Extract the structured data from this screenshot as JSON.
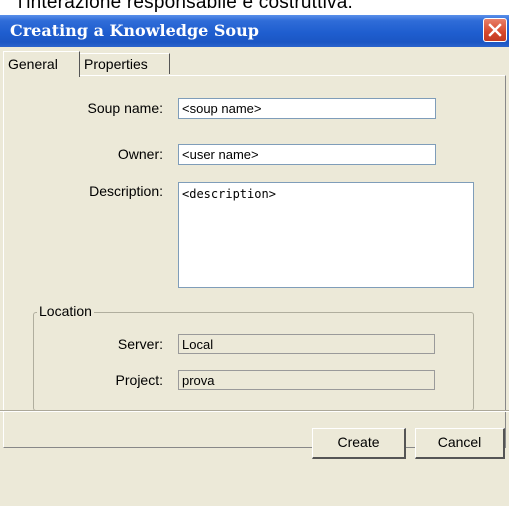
{
  "background_text": "l'interazione responsabile e costruttiva.",
  "window": {
    "title": "Creating a Knowledge Soup",
    "close_icon": "close-icon"
  },
  "tabs": [
    {
      "label": "General",
      "selected": true
    },
    {
      "label": "Properties",
      "selected": false
    }
  ],
  "form": {
    "soup_name_label": "Soup name:",
    "soup_name_value": "<soup name>",
    "owner_label": "Owner:",
    "owner_value": "<user name>",
    "description_label": "Description:",
    "description_value": "<description>"
  },
  "location": {
    "legend": "Location",
    "server_label": "Server:",
    "server_value": "Local",
    "project_label": "Project:",
    "project_value": "prova"
  },
  "buttons": {
    "create_label": "Create",
    "cancel_label": "Cancel"
  },
  "colors": {
    "titlebar": "#1f5ecf",
    "dialog_bg": "#ece9d8",
    "close_button": "#d6482c"
  }
}
